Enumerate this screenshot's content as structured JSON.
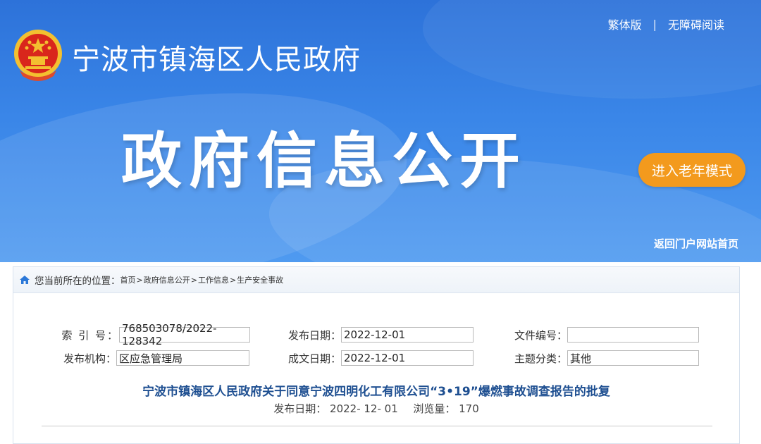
{
  "header": {
    "traditional_label": "繁体版",
    "separator": "|",
    "accessible_label": "无障碍阅读",
    "site_title": "宁波市镇海区人民政府",
    "hero_title": "政府信息公开",
    "elder_mode_label": "进入老年模式",
    "back_home_label": "返回门户网站首页"
  },
  "breadcrumb": {
    "prefix": "您当前所在的位置：",
    "items": [
      "首页",
      "政府信息公开",
      "工作信息",
      "生产安全事故"
    ]
  },
  "meta": {
    "index_label": "索  引  号：",
    "index_value": "768503078/2022-128342",
    "publish_date_label": "发布日期：",
    "publish_date_value": "2022-12-01",
    "doc_number_label": "文件编号：",
    "doc_number_value": "",
    "org_label": "发布机构：",
    "org_value": "区应急管理局",
    "create_date_label": "成文日期：",
    "create_date_value": "2022-12-01",
    "category_label": "主题分类：",
    "category_value": "其他"
  },
  "document": {
    "title": "宁波市镇海区人民政府关于同意宁波四明化工有限公司“3•19”爆燃事故调查报告的批复",
    "date_label": "发布日期：",
    "date_value": "2022- 12- 01",
    "views_label": "浏览量：",
    "views_value": "170"
  },
  "colors": {
    "banner_blue": "#3a86e8",
    "elder_button": "#f39a1d",
    "title_blue": "#1e4f91"
  }
}
